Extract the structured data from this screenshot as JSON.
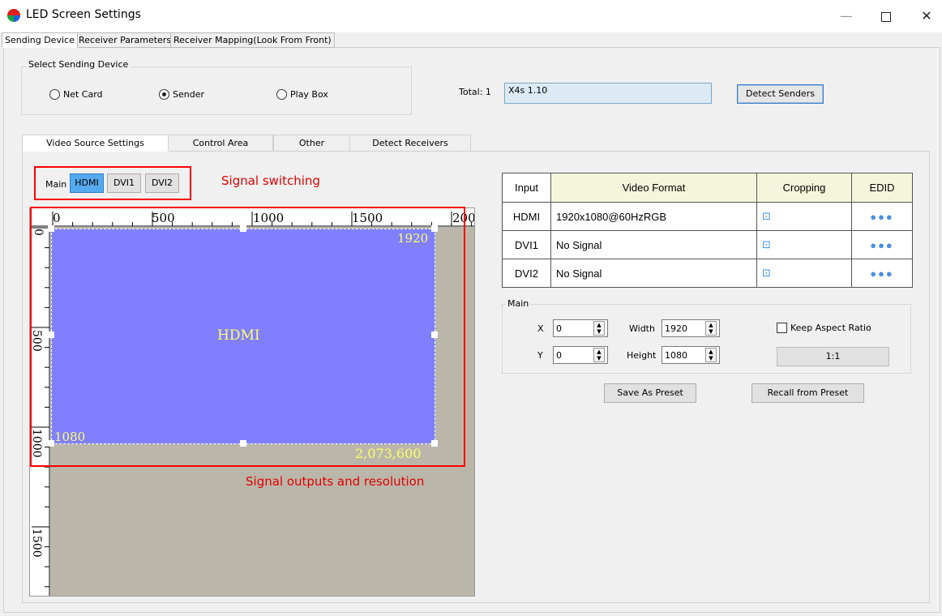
{
  "window": {
    "title": "LED Screen Settings",
    "minimize": "—",
    "close": "✕"
  },
  "top_tabs": [
    "Sending Device",
    "Receiver Parameters",
    "Receiver Mapping(Look From Front)"
  ],
  "select_group": {
    "title": "Select Sending Device",
    "options": [
      {
        "label": "Net Card",
        "selected": false
      },
      {
        "label": "Sender",
        "selected": true
      },
      {
        "label": "Play Box",
        "selected": false
      }
    ]
  },
  "total_label": "Total:  1",
  "sender_value": "X4s 1.10",
  "detect_senders": "Detect Senders",
  "inner_tabs": [
    "Video Source Settings",
    "Control Area",
    "Other",
    "Detect Receivers"
  ],
  "signal": {
    "main_label": "Main",
    "buttons": [
      {
        "label": "HDMI",
        "active": true
      },
      {
        "label": "DVI1",
        "active": false
      },
      {
        "label": "DVI2",
        "active": false
      }
    ]
  },
  "annotations": {
    "signal_switching": "Signal switching",
    "signal_outputs": "Signal outputs and resolution"
  },
  "canvas": {
    "ruler_x_labels": [
      "0",
      "500",
      "1000",
      "1500",
      "200"
    ],
    "ruler_y_labels": [
      "0",
      "500",
      "1000",
      "1500"
    ],
    "source_label": "HDMI",
    "width_value": "1920",
    "height_value": "1080",
    "pixel_total": "2,073,600",
    "colors": {
      "video_fill": "#8080ff",
      "canvas_bg": "#bab7aa",
      "label": "#ffff66"
    }
  },
  "table": {
    "headers": [
      "Input",
      "Video Format",
      "Cropping",
      "EDID"
    ],
    "rows": [
      {
        "input": "HDMI",
        "format": "1920x1080@60HzRGB"
      },
      {
        "input": "DVI1",
        "format": "No Signal"
      },
      {
        "input": "DVI2",
        "format": "No Signal"
      }
    ],
    "crop_icon": "crop-icon",
    "edid_icon": "more-dots-icon"
  },
  "position": {
    "group_title": "Main",
    "x_label": "X",
    "x_value": "0",
    "y_label": "Y",
    "y_value": "0",
    "width_label": "Width",
    "width_value": "1920",
    "height_label": "Height",
    "height_value": "1080",
    "keep_aspect": "Keep Aspect Ratio",
    "ratio_button": "1:1"
  },
  "presets": {
    "save": "Save As Preset",
    "recall": "Recall from Preset"
  }
}
